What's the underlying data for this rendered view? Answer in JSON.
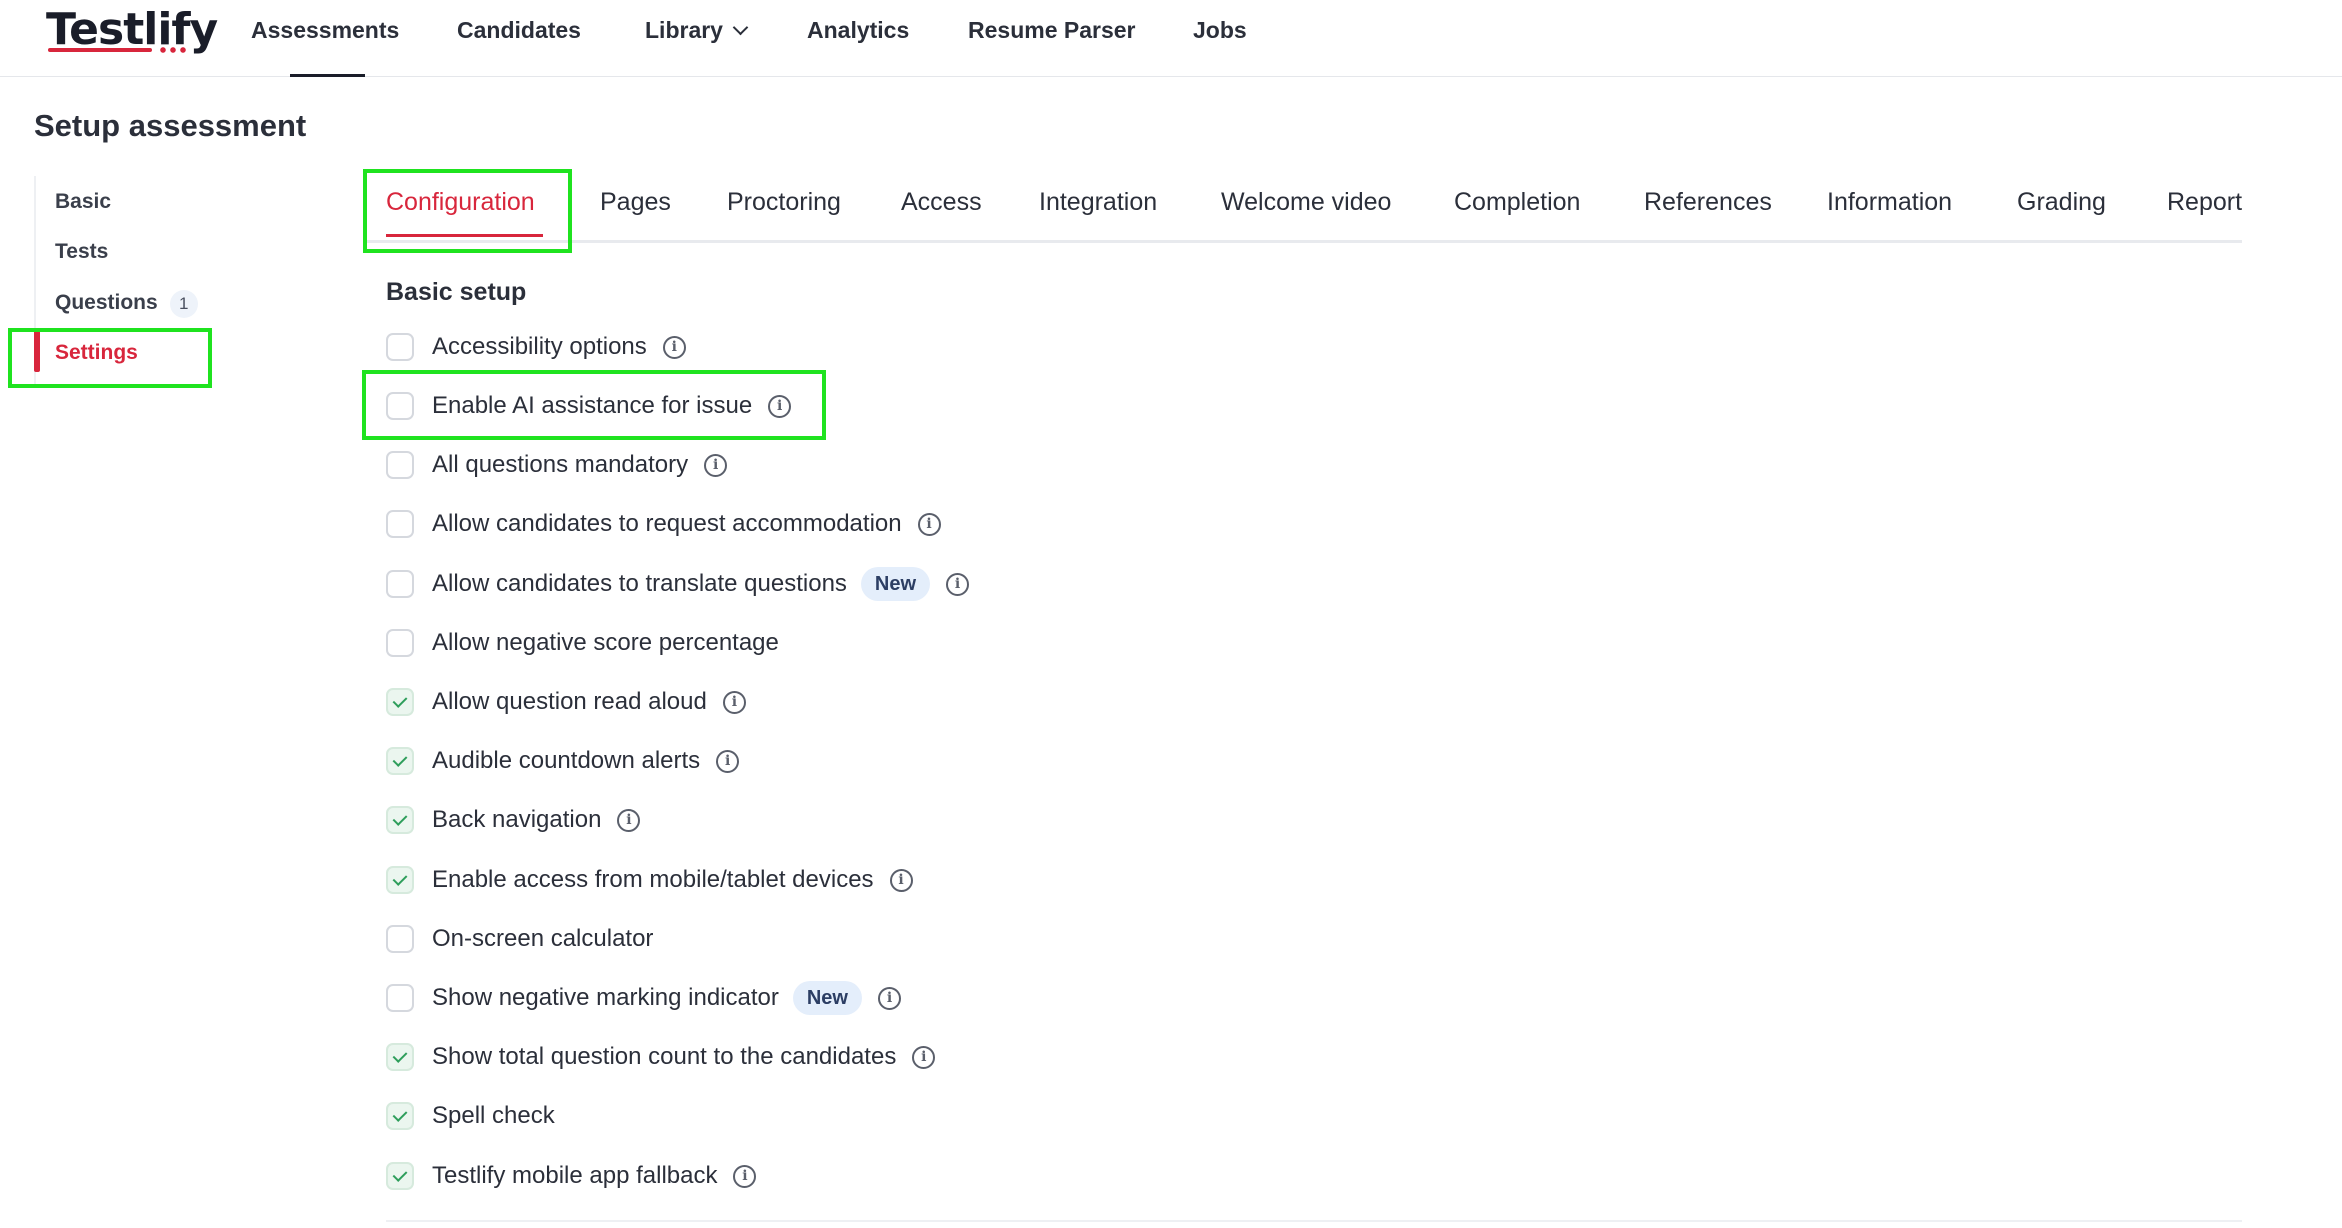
{
  "app": {
    "logo_text": "Testlify"
  },
  "topnav": {
    "items": [
      {
        "label": "Assessments"
      },
      {
        "label": "Candidates"
      },
      {
        "label": "Library"
      },
      {
        "label": "Analytics"
      },
      {
        "label": "Resume Parser"
      },
      {
        "label": "Jobs"
      }
    ]
  },
  "page": {
    "title": "Setup assessment"
  },
  "sidebar": {
    "items": [
      {
        "label": "Basic"
      },
      {
        "label": "Tests"
      },
      {
        "label": "Questions",
        "count": "1"
      },
      {
        "label": "Settings",
        "active": true
      }
    ]
  },
  "tabs": [
    {
      "label": "Configuration",
      "active": true
    },
    {
      "label": "Pages"
    },
    {
      "label": "Proctoring"
    },
    {
      "label": "Access"
    },
    {
      "label": "Integration"
    },
    {
      "label": "Welcome video"
    },
    {
      "label": "Completion"
    },
    {
      "label": "References"
    },
    {
      "label": "Information"
    },
    {
      "label": "Grading"
    },
    {
      "label": "Report"
    }
  ],
  "section": {
    "title": "Basic setup",
    "options": [
      {
        "label": "Accessibility options",
        "checked": false,
        "info": true
      },
      {
        "label": "Enable AI assistance for issue",
        "checked": false,
        "info": true
      },
      {
        "label": "All questions mandatory",
        "checked": false,
        "info": true
      },
      {
        "label": "Allow candidates to request accommodation",
        "checked": false,
        "info": true
      },
      {
        "label": "Allow candidates to translate questions",
        "checked": false,
        "info": true,
        "badge": "New"
      },
      {
        "label": "Allow negative score percentage",
        "checked": false,
        "info": false
      },
      {
        "label": "Allow question read aloud",
        "checked": true,
        "info": true
      },
      {
        "label": "Audible countdown alerts",
        "checked": true,
        "info": true
      },
      {
        "label": "Back navigation",
        "checked": true,
        "info": true
      },
      {
        "label": "Enable access from mobile/tablet devices",
        "checked": true,
        "info": true
      },
      {
        "label": "On-screen calculator",
        "checked": false,
        "info": false
      },
      {
        "label": "Show negative marking indicator",
        "checked": false,
        "info": true,
        "badge": "New"
      },
      {
        "label": "Show total question count to the candidates",
        "checked": true,
        "info": true
      },
      {
        "label": "Spell check",
        "checked": true,
        "info": false
      },
      {
        "label": "Testlify mobile app fallback",
        "checked": true,
        "info": true
      }
    ]
  },
  "icons": {
    "info": "info-circle-icon",
    "check": "checkmark-icon",
    "chevron": "chevron-down-icon"
  },
  "colors": {
    "brand_red": "#d8263c",
    "check_green": "#2e9e5b",
    "highlight_green": "#1fe31f",
    "badge_bg": "#e4eefb"
  }
}
